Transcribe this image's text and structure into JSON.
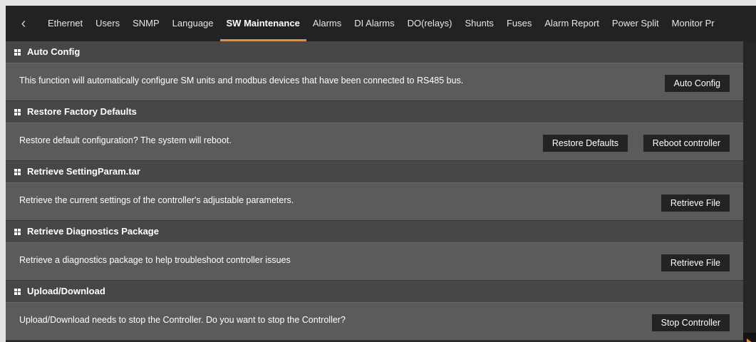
{
  "tabs": [
    "Ethernet",
    "Users",
    "SNMP",
    "Language",
    "SW Maintenance",
    "Alarms",
    "DI Alarms",
    "DO(relays)",
    "Shunts",
    "Fuses",
    "Alarm Report",
    "Power Split",
    "Monitor Pr"
  ],
  "active_tab": "SW Maintenance",
  "colors": {
    "accent": "#f28c28",
    "header_bg": "#474747",
    "body_bg": "#5b5b5b",
    "button_bg": "#232323"
  },
  "sections": [
    {
      "title": "Auto Config",
      "text": "This function will automatically configure SM units and modbus devices that have been connected to RS485 bus.",
      "buttons": [
        "Auto Config"
      ]
    },
    {
      "title": "Restore Factory Defaults",
      "text": "Restore default configuration? The system will reboot.",
      "buttons": [
        "Restore Defaults",
        "Reboot controller"
      ]
    },
    {
      "title": "Retrieve SettingParam.tar",
      "text": "Retrieve the current settings of the controller's adjustable parameters.",
      "buttons": [
        "Retrieve File"
      ]
    },
    {
      "title": "Retrieve Diagnostics Package",
      "text": "Retrieve a diagnostics package to help troubleshoot controller issues",
      "buttons": [
        "Retrieve File"
      ]
    },
    {
      "title": "Upload/Download",
      "text": "Upload/Download needs to stop the Controller. Do you want to stop the Controller?",
      "buttons": [
        "Stop Controller"
      ]
    }
  ]
}
